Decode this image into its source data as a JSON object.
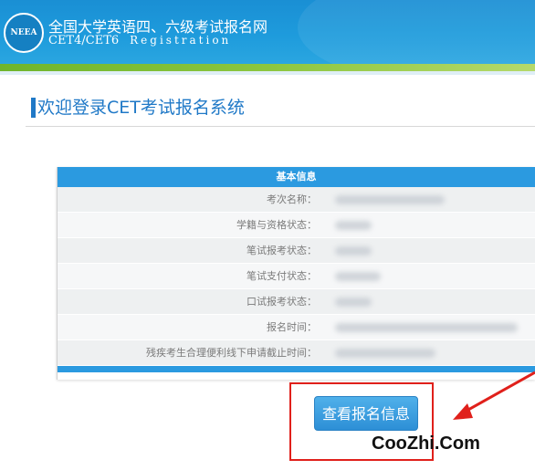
{
  "header": {
    "logo_text": "NEEA",
    "site_name_cn": "全国大学英语四、六级考试报名网",
    "site_name_en": "CET4/CET6",
    "registration": "Registration"
  },
  "page": {
    "title": "欢迎登录CET考试报名系统"
  },
  "info_table": {
    "heading": "基本信息",
    "rows": [
      {
        "label": "考次名称："
      },
      {
        "label": "学籍与资格状态："
      },
      {
        "label": "笔试报考状态："
      },
      {
        "label": "笔试支付状态："
      },
      {
        "label": "口试报考状态："
      },
      {
        "label": "报名时间："
      },
      {
        "label": "残疾考生合理便利线下申请截止时间："
      }
    ]
  },
  "actions": {
    "view_registration_label": "查看报名信息"
  },
  "annotations": {
    "highlight_color": "#e0201b",
    "arrow_color": "#e0201b"
  },
  "watermark": "CooZhi.Com",
  "colors": {
    "header_blue": "#1e9bdc",
    "accent_green": "#8cc63f",
    "title_blue": "#2079c7",
    "table_head": "#2b9ae0"
  }
}
